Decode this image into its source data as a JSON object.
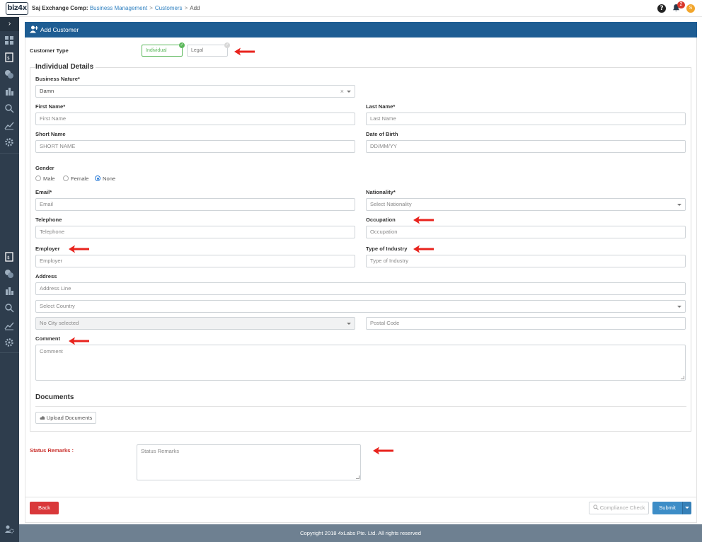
{
  "header": {
    "logo_text": "biz4x",
    "company": "Saj Exchange Comp:",
    "breadcrumb": [
      "Business Management",
      "Customers",
      "Add"
    ],
    "separator": ">",
    "notification_count": "2",
    "avatar_initial": "S"
  },
  "sidebar": {
    "toggle": "›",
    "icons": [
      "dashboard-icon",
      "document-icon",
      "exchange-icon",
      "building-icon",
      "search-icon",
      "chart-icon",
      "settings-icon",
      "document-icon",
      "exchange-icon",
      "building-icon",
      "search-icon",
      "chart-icon",
      "settings-icon",
      "user-settings-icon"
    ]
  },
  "panel": {
    "title": "Add Customer"
  },
  "form": {
    "customer_type": {
      "label": "Customer Type",
      "options": [
        "Individual",
        "Legal"
      ],
      "selected": "Individual"
    },
    "section_title": "Individual Details",
    "business_nature": {
      "label": "Business Nature*",
      "value": "Damn"
    },
    "first_name": {
      "label": "First Name*",
      "placeholder": "First Name"
    },
    "last_name": {
      "label": "Last Name*",
      "placeholder": "Last Name"
    },
    "short_name": {
      "label": "Short Name",
      "placeholder": "SHORT NAME"
    },
    "dob": {
      "label": "Date of Birth",
      "placeholder": "DD/MM/YY"
    },
    "gender": {
      "label": "Gender",
      "options": [
        "Male",
        "Female",
        "None"
      ],
      "selected": "None"
    },
    "email": {
      "label": "Email*",
      "placeholder": "Email"
    },
    "nationality": {
      "label": "Nationality*",
      "placeholder": "Select Nationality"
    },
    "telephone": {
      "label": "Telephone",
      "placeholder": "Telephone"
    },
    "occupation": {
      "label": "Occupation",
      "placeholder": "Occupation"
    },
    "employer": {
      "label": "Employer",
      "placeholder": "Employer"
    },
    "industry": {
      "label": "Type of Industry",
      "placeholder": "Type of Industry"
    },
    "address": {
      "label": "Address",
      "line_placeholder": "Address Line",
      "country_placeholder": "Select Country",
      "city_placeholder": "No City selected",
      "postal_placeholder": "Postal Code"
    },
    "comment": {
      "label": "Comment",
      "placeholder": "Comment"
    },
    "documents": {
      "title": "Documents",
      "upload_label": "Upload Documents"
    },
    "status_remarks": {
      "label": "Status Remarks :",
      "placeholder": "Status Remarks"
    }
  },
  "actions": {
    "back": "Back",
    "compliance": "Compliance Check",
    "submit": "Submit"
  },
  "footer": {
    "copyright": "Copyright 2018 4xLabs Pte. Ltd. All rights reserved"
  },
  "colors": {
    "header_blue": "#1e5d93",
    "sidebar": "#2e3d4d",
    "back_red": "#d9383a",
    "submit_blue": "#3d8dc7",
    "active_green": "#5cb85c",
    "annotation_red": "#e8231d"
  }
}
